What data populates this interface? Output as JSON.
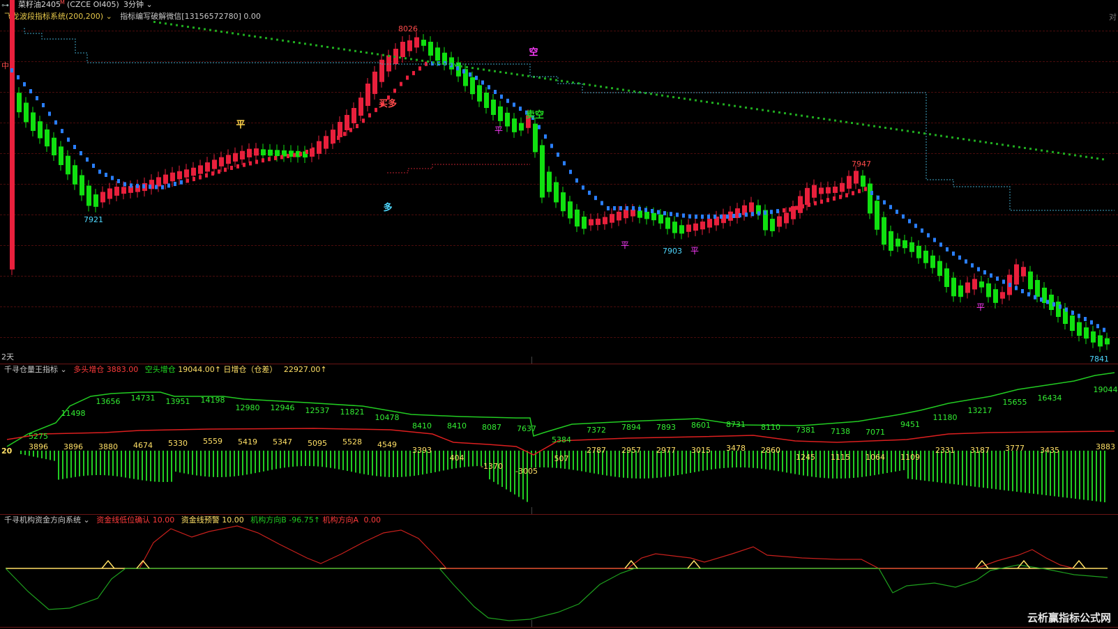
{
  "toolbar": {
    "symbol": "菜籽油2405",
    "symbol_mark": "M",
    "exchange_code": "(CZCE OI405)",
    "period": "3分钟",
    "right_mark": "对"
  },
  "main_panel": {
    "indicator_name": "飞龙波段指标系统(200,200)",
    "author_text": "指标编写破解微信[13156572780] 0.00",
    "corner_label": "2天",
    "left_edge_mark": "中",
    "price_labels": [
      {
        "text": "8026",
        "color": "#ff4b4b"
      },
      {
        "text": "7921",
        "color": "#4fd8ff"
      },
      {
        "text": "7903",
        "color": "#4fd8ff"
      },
      {
        "text": "7947",
        "color": "#ff4b4b"
      },
      {
        "text": "7841",
        "color": "#4fd8ff"
      }
    ],
    "signals": [
      {
        "text": "平",
        "color": "#ffd34a"
      },
      {
        "text": "买多",
        "color": "#ff4b4b"
      },
      {
        "text": "空",
        "color": "#ff3cff"
      },
      {
        "text": "卖空",
        "color": "#22e022"
      },
      {
        "text": "多",
        "color": "#4fd8ff"
      },
      {
        "text": "平",
        "color": "#ff3cff"
      },
      {
        "text": "平",
        "color": "#ff3cff"
      },
      {
        "text": "平",
        "color": "#ff3cff"
      },
      {
        "text": "平",
        "color": "#ff3cff"
      }
    ]
  },
  "oi_panel": {
    "indicator_name": "千寻仓量王指标",
    "long_label": "多头增仓",
    "long_value": "3883.00",
    "short_label": "空头增仓",
    "short_value": "19044.00↑",
    "daily_label": "日增仓（仓差）",
    "daily_value": "22927.00↑",
    "green_values": [
      "5275",
      "11498",
      "13656",
      "14731",
      "13951",
      "14198",
      "12980",
      "12946",
      "12537",
      "11821",
      "10478",
      "8410",
      "8410",
      "8087",
      "7637",
      "5384",
      "7372",
      "7894",
      "7893",
      "8601",
      "8731",
      "8110",
      "7381",
      "7138",
      "7071",
      "9451",
      "11180",
      "13217",
      "15655",
      "16434",
      "19044"
    ],
    "red_values": [
      "3896",
      "3896",
      "3880",
      "4674",
      "5330",
      "5559",
      "5419",
      "5347",
      "5095",
      "5528",
      "4549",
      "3393",
      "2787",
      "2957",
      "2977",
      "3015",
      "3478",
      "2860",
      "2331",
      "3187",
      "3777",
      "3435",
      "3883"
    ],
    "bar_values": [
      "404",
      "-1370",
      "-3005",
      "507",
      "1245",
      "1115",
      "1064",
      "1109"
    ],
    "left_marker": "20"
  },
  "fund_panel": {
    "indicator_name": "千寻机构资金方向系统",
    "confirm_label": "资金线低位确认",
    "confirm_value": "10.00",
    "warn_label": "资金线预警",
    "warn_value": "10.00",
    "dir_b_label": "机构方向B",
    "dir_b_value": "-96.75↑",
    "dir_a_label": "机构方向A",
    "dir_a_value": "0.00"
  },
  "watermark": "云析赢指标公式网",
  "colors": {
    "up_candle": "#e8203c",
    "down_candle": "#10e010",
    "sar_up": "#e8203c",
    "sar_down": "#2a7fff",
    "trend_dots": "#1faa1f",
    "cyan_line": "#3fa8c8",
    "green_line": "#22cc22",
    "red_line": "#dd1f1f",
    "yellow": "#ffe066",
    "magenta": "#ff3cff"
  }
}
